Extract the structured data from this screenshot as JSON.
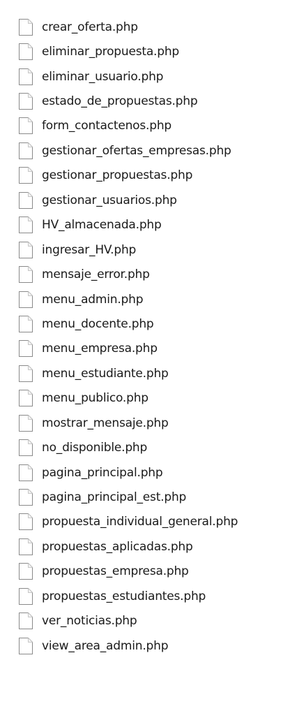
{
  "files": [
    {
      "name": "crear_oferta.php",
      "icon": "document-icon"
    },
    {
      "name": "eliminar_propuesta.php",
      "icon": "document-icon"
    },
    {
      "name": "eliminar_usuario.php",
      "icon": "document-icon"
    },
    {
      "name": "estado_de_propuestas.php",
      "icon": "document-icon"
    },
    {
      "name": "form_contactenos.php",
      "icon": "document-icon"
    },
    {
      "name": "gestionar_ofertas_empresas.php",
      "icon": "document-icon"
    },
    {
      "name": "gestionar_propuestas.php",
      "icon": "document-icon"
    },
    {
      "name": "gestionar_usuarios.php",
      "icon": "document-icon"
    },
    {
      "name": "HV_almacenada.php",
      "icon": "document-icon"
    },
    {
      "name": "ingresar_HV.php",
      "icon": "document-icon"
    },
    {
      "name": "mensaje_error.php",
      "icon": "document-icon"
    },
    {
      "name": "menu_admin.php",
      "icon": "document-icon"
    },
    {
      "name": "menu_docente.php",
      "icon": "document-icon"
    },
    {
      "name": "menu_empresa.php",
      "icon": "document-icon"
    },
    {
      "name": "menu_estudiante.php",
      "icon": "document-icon"
    },
    {
      "name": "menu_publico.php",
      "icon": "document-icon"
    },
    {
      "name": "mostrar_mensaje.php",
      "icon": "document-icon"
    },
    {
      "name": "no_disponible.php",
      "icon": "document-icon"
    },
    {
      "name": "pagina_principal.php",
      "icon": "document-icon"
    },
    {
      "name": "pagina_principal_est.php",
      "icon": "document-icon"
    },
    {
      "name": "propuesta_individual_general.php",
      "icon": "document-icon"
    },
    {
      "name": "propuestas_aplicadas.php",
      "icon": "document-icon"
    },
    {
      "name": "propuestas_empresa.php",
      "icon": "document-icon"
    },
    {
      "name": "propuestas_estudiantes.php",
      "icon": "document-icon"
    },
    {
      "name": "ver_noticias.php",
      "icon": "document-icon"
    },
    {
      "name": "view_area_admin.php",
      "icon": "document-icon"
    }
  ],
  "colors": {
    "icon_border": "#8a8a8a",
    "icon_fold": "#c8c8c8",
    "text": "#1a1a1a",
    "background": "#ffffff"
  }
}
